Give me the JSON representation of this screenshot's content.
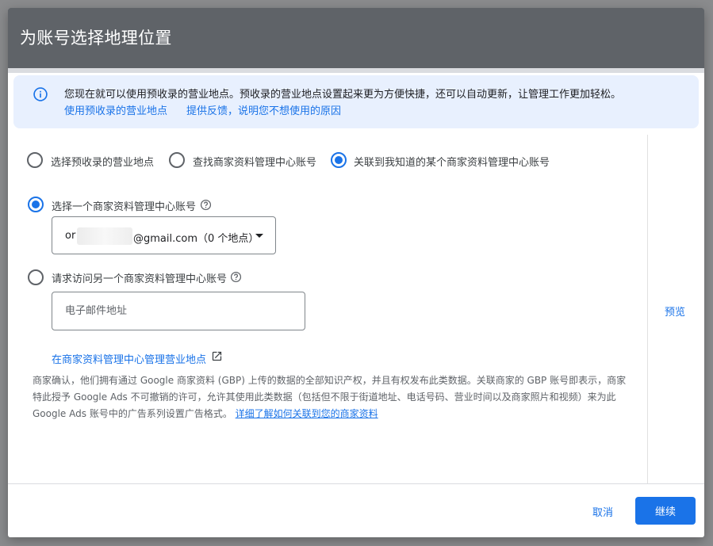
{
  "dialog": {
    "title": "为账号选择地理位置"
  },
  "banner": {
    "icon": "info-icon",
    "text": "您现在就可以使用预收录的营业地点。预收录的营业地点设置起来更为方便快捷，还可以自动更新，让管理工作更加轻松。",
    "link_preloaded": "使用预收录的营业地点",
    "link_feedback": "提供反馈，说明您不想使用的原因"
  },
  "options": {
    "preloaded": {
      "label": "选择预收录的营业地点",
      "checked": false
    },
    "find": {
      "label": "查找商家资料管理中心账号",
      "checked": false
    },
    "link": {
      "label": "关联到我知道的某个商家资料管理中心账号",
      "checked": true
    }
  },
  "choose_account": {
    "label": "选择一个商家资料管理中心账号",
    "checked": true,
    "select_prefix": "or",
    "select_suffix": "@gmail.com（0 个地点）"
  },
  "request_access": {
    "label": "请求访问另一个商家资料管理中心账号",
    "checked": false,
    "email_placeholder": "电子邮件地址"
  },
  "manage_link": "在商家资料管理中心管理营业地点",
  "disclaimer": {
    "text": "商家确认，他们拥有通过 Google 商家资料 (GBP) 上传的数据的全部知识产权，并且有权发布此类数据。关联商家的 GBP 账号即表示，商家特此授予 Google Ads 不可撤销的许可，允许其使用此类数据（包括但不限于街道地址、电话号码、营业时间以及商家照片和视频）来为此 Google Ads 账号中的广告系列设置广告格式。",
    "link": "详细了解如何关联到您的商家资料"
  },
  "preview": "预览",
  "footer": {
    "cancel": "取消",
    "continue": "继续"
  },
  "colors": {
    "header": "#5f6368",
    "accent": "#1a73e8",
    "banner_bg": "#e8f0fe"
  }
}
